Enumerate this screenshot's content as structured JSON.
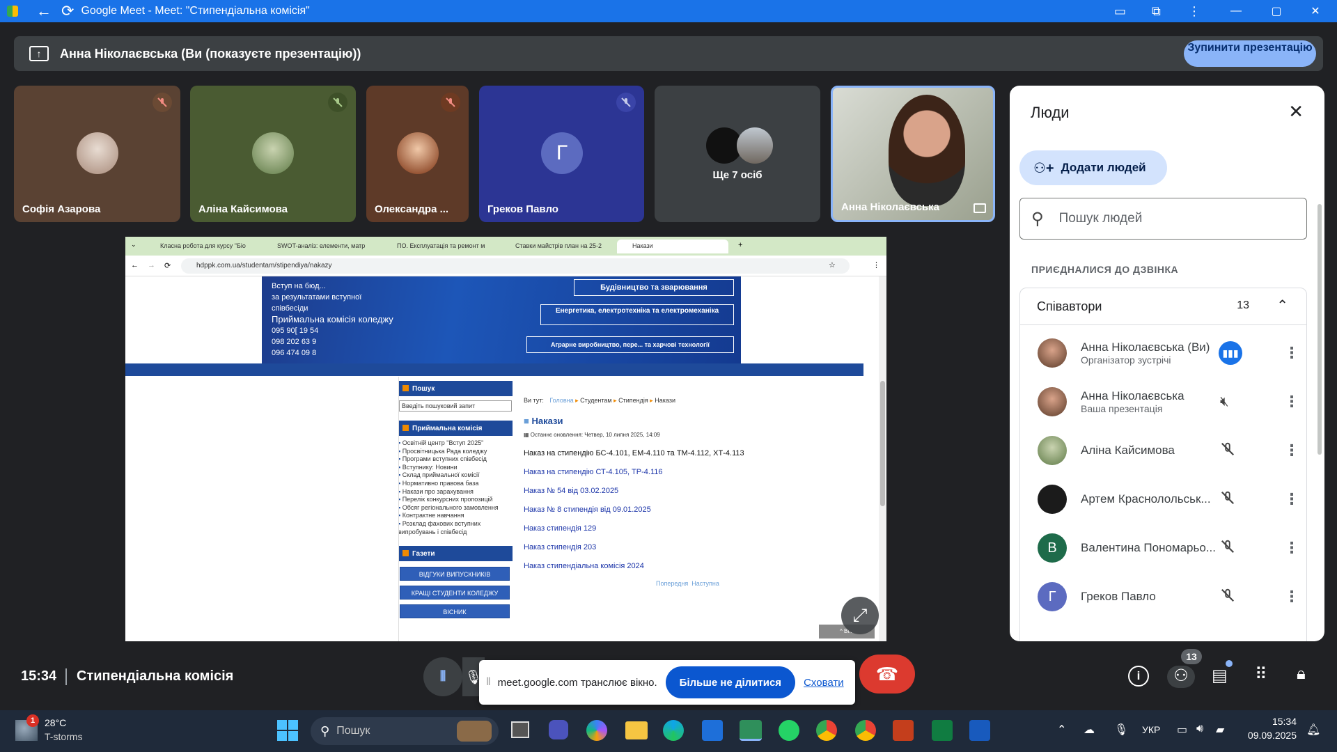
{
  "window": {
    "title": "Google Meet - Meet: \"Стипендіальна комісія\""
  },
  "presentation": {
    "label": "Анна Ніколаєвська (Ви (показуєте презентацію))",
    "stop_button": "Зупинити презентацію"
  },
  "tiles": [
    {
      "name": "Софія Азарова",
      "muted": true
    },
    {
      "name": "Аліна Кайсимова",
      "muted": true
    },
    {
      "name": "Олександра ...",
      "muted": true
    },
    {
      "name": "Греков Павло",
      "initial": "Г",
      "muted": true
    },
    {
      "name": "Ще 7 осіб"
    },
    {
      "name": "Анна Ніколаєвська"
    }
  ],
  "people_panel": {
    "title": "Люди",
    "add_button": "Додати людей",
    "search_placeholder": "Пошук людей",
    "section_label": "ПРИЄДНАЛИСЯ ДО ДЗВІНКА",
    "group_label": "Співавтори",
    "group_count": "13",
    "participants": [
      {
        "name": "Анна Ніколаєвська (Ви)",
        "sub": "Організатор зустрічі",
        "status": "speaking"
      },
      {
        "name": "Анна Ніколаєвська",
        "sub": "Ваша презентація",
        "status": "sound-off"
      },
      {
        "name": "Аліна Кайсимова",
        "status": "muted"
      },
      {
        "name": "Артем Краснолольськ...",
        "status": "muted"
      },
      {
        "name": "Валентина Пономарьо...",
        "initial": "В",
        "status": "muted"
      },
      {
        "name": "Греков Павло",
        "initial": "Г",
        "status": "muted"
      }
    ]
  },
  "shared_screen": {
    "tabs": [
      "Класна робота для курсу \"Біо",
      "SWOT-аналіз: елементи, матр",
      "ПО. Експлуатація та ремонт м",
      "Ставки майстрів план на 25-2",
      "Накази"
    ],
    "url": "hdppk.com.ua/studentam/stipendiya/nakazy",
    "banner": {
      "left_lines": [
        "Вступ на бюд...",
        "за результатами вступної співбесіди",
        "Приймальна комісія коледжу",
        "095 90[ 19 54",
        "098 202 63 9",
        "096 474 09 8"
      ],
      "right_lines": [
        "Будівництво та зварювання",
        "Енергетика, електротехніка та електромеханіка",
        "Аграрне виробництво, пере... та харчові технології"
      ]
    },
    "sidebar": {
      "search_head": "Пошук",
      "search_placeholder": "Введіть пошуковий запит",
      "admission_head": "Приймальна комісія",
      "admission_items": [
        "Освітній центр \"Вступ 2025\"",
        "Просвітницька Рада коледжу",
        "Програми вступних співбесід",
        "Вступнику: Новини",
        "Склад приймальної комісії",
        "Нормативно правова база",
        "Накази про зарахування",
        "Перелік конкурсних пропозицій",
        "Обсяг регіонального замовлення",
        "Контрактне навчання",
        "Розклад фахових вступних випробувань і співбесід"
      ],
      "newspapers_head": "Газети",
      "buttons": [
        "ВІДГУКИ ВИПУСКНИКІВ",
        "КРАЩІ СТУДЕНТИ КОЛЕДЖУ",
        "ВІСНИК"
      ]
    },
    "breadcrumb": {
      "prefix": "Ви тут:",
      "items": [
        "Головна",
        "Студентам",
        "Стипендія",
        "Накази"
      ]
    },
    "heading": "Накази",
    "updated": "Останнє оновлення: Четвер, 10 липня 2025, 14:09",
    "links": [
      "Наказ на стипендію БС-4.101, ЕМ-4.110 та ТМ-4.112, ХТ-4.113",
      "Наказ на стипендію СТ-4.105, ТР-4.116",
      "Наказ № 54 від 03.02.2025",
      "Наказ № 8 стипендія від 09.01.2025",
      "Наказ стипендія 129",
      "Наказ стипендія 203",
      "Наказ стипендіальна комісія 2024"
    ],
    "pager": "Попередня  Наступна",
    "up_btn": "^ Вг..."
  },
  "bottom": {
    "time": "15:34",
    "meeting_name": "Стипендіальна комісія",
    "people_badge": "13"
  },
  "share_notice": {
    "text": "meet.google.com транслює вікно.",
    "stop": "Більше не ділитися",
    "hide": "Сховати"
  },
  "taskbar": {
    "weather_temp": "28°C",
    "weather_desc": "T-storms",
    "weather_badge": "1",
    "search": "Пошук",
    "lang": "УКР",
    "clock_time": "15:34",
    "clock_date": "09.09.2025"
  }
}
